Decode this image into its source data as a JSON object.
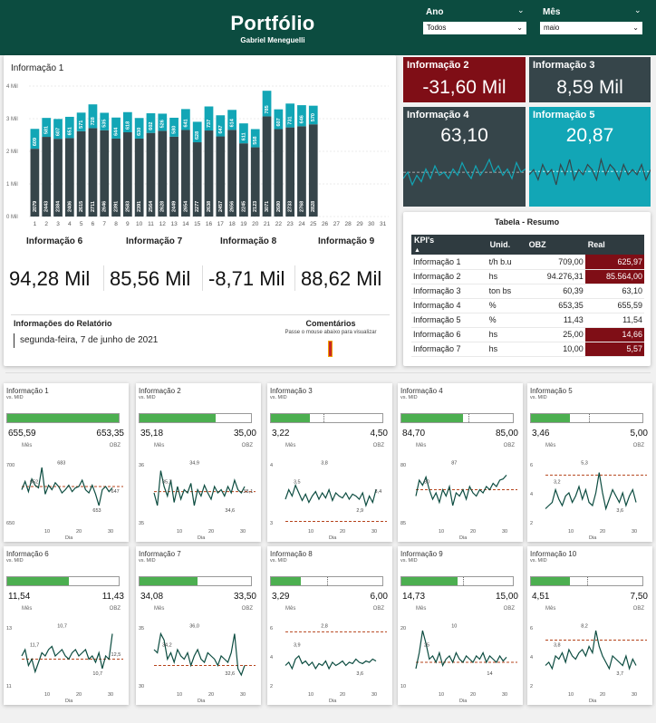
{
  "header": {
    "title": "Portfólio",
    "subtitle": "Gabriel Meneguelli",
    "ano_label": "Ano",
    "ano_value": "Todos",
    "mes_label": "Mês",
    "mes_value": "maio"
  },
  "colors": {
    "header": "#0c4c40",
    "dark": "#36454a",
    "teal": "#12a6b6",
    "red": "#7f0e16",
    "green": "#4caf50"
  },
  "main_panel": {
    "title": "Informação 1",
    "kpis": [
      {
        "label": "Informação 6",
        "value": "94,28 Mil"
      },
      {
        "label": "Informação 7",
        "value": "85,56 Mil"
      },
      {
        "label": "Informação 8",
        "value": "-8,71 Mil"
      },
      {
        "label": "Informação 9",
        "value": "88,62 Mil"
      }
    ],
    "report_label": "Informações do Relatório",
    "report_date": "segunda-feira, 7 de junho de 2021",
    "comments_label": "Comentários",
    "comments_hint": "Passe o mouse abaixo para visualizar"
  },
  "chart_data": {
    "type": "bar",
    "categories": [
      "1",
      "2",
      "3",
      "4",
      "5",
      "6",
      "7",
      "8",
      "9",
      "10",
      "11",
      "12",
      "13",
      "14",
      "15",
      "16",
      "17",
      "18",
      "19",
      "20",
      "21",
      "22",
      "23",
      "24",
      "25",
      "26",
      "27",
      "28",
      "29",
      "30",
      "31"
    ],
    "y_ticks": [
      "0 Mil",
      "1 Mil",
      "2 Mil",
      "3 Mil",
      "4 Mil"
    ],
    "ylim": [
      0,
      4000
    ],
    "series": [
      {
        "values": [
          2079,
          2443,
          2384,
          2406,
          2615,
          2711,
          2646,
          2391,
          2583,
          2391,
          2564,
          2628,
          2449,
          2654,
          2277,
          2638,
          2457,
          2656,
          2245,
          2123,
          3071,
          2680,
          2733,
          2768,
          2828,
          null,
          null,
          null,
          null,
          null,
          null
        ],
        "labels": [
          "2079",
          "2443",
          "2384",
          "2406",
          "2615",
          "2711",
          "2646",
          "2391",
          "2583",
          "2391",
          "2564",
          "2628",
          "2449",
          "2654",
          "2277",
          "2638",
          "2457",
          "2656",
          "2245",
          "2123",
          "3071",
          "2680",
          "2733",
          "2768",
          "2828",
          "",
          "",
          "",
          "",
          "",
          ""
        ]
      },
      {
        "values": [
          609,
          581,
          607,
          651,
          571,
          728,
          535,
          644,
          618,
          630,
          602,
          526,
          580,
          641,
          628,
          737,
          647,
          614,
          611,
          558,
          785,
          607,
          731,
          646,
          570,
          null,
          null,
          null,
          null,
          null,
          null
        ],
        "labels": [
          "609",
          "581",
          "607",
          "651",
          "571",
          "728",
          "535",
          "644",
          "618",
          "630",
          "602",
          "526",
          "580",
          "641",
          "628",
          "737",
          "647",
          "614",
          "611",
          "558",
          "785",
          "607",
          "731",
          "646",
          "570",
          "",
          "",
          "",
          "",
          "",
          ""
        ]
      }
    ]
  },
  "cards": [
    {
      "label": "Informação 2",
      "value": "-31,60 Mil",
      "color": "#7f0e16"
    },
    {
      "label": "Informação 3",
      "value": "8,59 Mil",
      "color": "#36454a"
    },
    {
      "label": "Informação 4",
      "value": "63,10",
      "color": "#36454a"
    },
    {
      "label": "Informação 5",
      "value": "20,87",
      "color": "#12a6b6"
    }
  ],
  "spark4": [
    60,
    62,
    58,
    61,
    59,
    63,
    60,
    64,
    61,
    62,
    60,
    63,
    61,
    65,
    62,
    60,
    64,
    61,
    63,
    66,
    62,
    64,
    61,
    63,
    60,
    65,
    62,
    63
  ],
  "spark5": [
    20,
    21,
    19,
    22,
    20,
    21,
    18,
    22,
    20,
    23,
    19,
    21,
    20,
    22,
    21,
    19,
    23,
    20,
    22,
    21,
    19,
    22,
    20,
    21,
    20,
    22,
    19,
    21
  ],
  "table": {
    "title": "Tabela - Resumo",
    "headers": [
      "KPI's",
      "Unid.",
      "OBZ",
      "Real"
    ],
    "rows": [
      {
        "kpi": "Informação 1",
        "unid": "t/h b.u",
        "obz": "709,00",
        "real": "625,97",
        "red": true
      },
      {
        "kpi": "Informação 2",
        "unid": "hs",
        "obz": "94.276,31",
        "real": "85.564,00",
        "red": true
      },
      {
        "kpi": "Informação 3",
        "unid": "ton bs",
        "obz": "60,39",
        "real": "63,10",
        "red": false
      },
      {
        "kpi": "Informação 4",
        "unid": "%",
        "obz": "653,35",
        "real": "655,59",
        "red": false
      },
      {
        "kpi": "Informação 5",
        "unid": "%",
        "obz": "11,43",
        "real": "11,54",
        "red": false
      },
      {
        "kpi": "Informação 6",
        "unid": "hs",
        "obz": "25,00",
        "real": "14,66",
        "red": true
      },
      {
        "kpi": "Informação 7",
        "unid": "hs",
        "obz": "10,00",
        "real": "5,57",
        "red": true
      }
    ]
  },
  "mini_common": {
    "sub": "vs. MID",
    "mes": "Mês",
    "obz": "OBZ",
    "dia": "Dia",
    "x_ticks": [
      "10",
      "20",
      "30"
    ]
  },
  "minis": [
    {
      "title": "Informação 1",
      "v1": "655,59",
      "v2": "653,35",
      "fill": 1.0,
      "target": null,
      "y_labels": [
        "700",
        "650"
      ],
      "pt": [
        "652",
        "683",
        "653",
        "647"
      ],
      "ref": 0.6,
      "pts": [
        0.55,
        0.68,
        0.52,
        0.72,
        0.62,
        0.58,
        0.9,
        0.48,
        0.62,
        0.55,
        0.66,
        0.6,
        0.5,
        0.55,
        0.62,
        0.52,
        0.58,
        0.6,
        0.7,
        0.55,
        0.5,
        0.62,
        0.48,
        0.3,
        0.55,
        0.6,
        0.52,
        0.58
      ]
    },
    {
      "title": "Informação 2",
      "v1": "35,18",
      "v2": "35,00",
      "fill": 0.68,
      "target": null,
      "y_labels": [
        "36",
        "35"
      ],
      "pt": [
        "35,7",
        "34,9",
        "34,6",
        "35,1"
      ],
      "ref": 0.52,
      "pts": [
        0.5,
        0.3,
        0.85,
        0.6,
        0.45,
        0.7,
        0.35,
        0.6,
        0.4,
        0.55,
        0.5,
        0.65,
        0.3,
        0.55,
        0.45,
        0.62,
        0.5,
        0.4,
        0.6,
        0.5,
        0.55,
        0.45,
        0.6,
        0.5,
        0.7,
        0.55,
        0.5,
        0.6
      ]
    },
    {
      "title": "Informação 3",
      "v1": "3,22",
      "v2": "4,50",
      "fill": 0.35,
      "target": 0.47,
      "y_labels": [
        "4",
        "3"
      ],
      "pt": [
        "3,5",
        "3,8",
        "2,9",
        "3,4"
      ],
      "ref": 0.05,
      "pts": [
        0.4,
        0.55,
        0.45,
        0.62,
        0.5,
        0.38,
        0.48,
        0.35,
        0.45,
        0.52,
        0.4,
        0.5,
        0.42,
        0.55,
        0.38,
        0.5,
        0.45,
        0.42,
        0.5,
        0.4,
        0.48,
        0.45,
        0.4,
        0.5,
        0.3,
        0.45,
        0.35,
        0.55
      ]
    },
    {
      "title": "Informação 4",
      "v1": "84,70",
      "v2": "85,00",
      "fill": 0.55,
      "target": 0.6,
      "y_labels": [
        "80",
        "85"
      ],
      "pt": [
        "80",
        "87"
      ],
      "ref": 0.55,
      "pts": [
        0.45,
        0.7,
        0.62,
        0.75,
        0.55,
        0.4,
        0.5,
        0.35,
        0.55,
        0.45,
        0.6,
        0.3,
        0.5,
        0.45,
        0.55,
        0.4,
        0.6,
        0.5,
        0.45,
        0.55,
        0.5,
        0.6,
        0.55,
        0.65,
        0.6,
        0.7,
        0.72,
        0.78
      ]
    },
    {
      "title": "Informação 5",
      "v1": "3,46",
      "v2": "5,00",
      "fill": 0.35,
      "target": 0.52,
      "y_labels": [
        "6",
        "4",
        "2"
      ],
      "pt": [
        "3,2",
        "5,3",
        "3,6"
      ],
      "ref": 0.78,
      "pts": [
        0.25,
        0.3,
        0.35,
        0.55,
        0.4,
        0.3,
        0.45,
        0.5,
        0.35,
        0.45,
        0.6,
        0.4,
        0.55,
        0.35,
        0.3,
        0.5,
        0.82,
        0.5,
        0.25,
        0.4,
        0.55,
        0.45,
        0.35,
        0.5,
        0.3,
        0.45,
        0.55,
        0.35
      ]
    },
    {
      "title": "Informação 6",
      "v1": "11,54",
      "v2": "11,43",
      "fill": 0.55,
      "target": null,
      "y_labels": [
        "13",
        "11"
      ],
      "pt": [
        "11,7",
        "10,7",
        "10,7",
        "12,5"
      ],
      "ref": 0.45,
      "pts": [
        0.5,
        0.6,
        0.35,
        0.45,
        0.25,
        0.4,
        0.55,
        0.5,
        0.6,
        0.65,
        0.5,
        0.55,
        0.6,
        0.5,
        0.45,
        0.55,
        0.6,
        0.5,
        0.55,
        0.6,
        0.45,
        0.5,
        0.4,
        0.55,
        0.3,
        0.5,
        0.45,
        0.85
      ]
    },
    {
      "title": "Informação 7",
      "v1": "34,08",
      "v2": "33,50",
      "fill": 0.52,
      "target": null,
      "y_labels": [
        "35",
        "30"
      ],
      "pt": [
        "34,2",
        "36,0",
        "32,6"
      ],
      "ref": 0.35,
      "pts": [
        0.6,
        0.55,
        0.85,
        0.75,
        0.45,
        0.55,
        0.4,
        0.6,
        0.5,
        0.45,
        0.55,
        0.35,
        0.5,
        0.6,
        0.45,
        0.4,
        0.55,
        0.5,
        0.45,
        0.35,
        0.5,
        0.45,
        0.4,
        0.55,
        0.85,
        0.3,
        0.2,
        0.35
      ]
    },
    {
      "title": "Informação 8",
      "v1": "3,29",
      "v2": "6,00",
      "fill": 0.27,
      "target": 0.5,
      "y_labels": [
        "6",
        "4",
        "2"
      ],
      "pt": [
        "3,9",
        "2,8",
        "3,6"
      ],
      "ref": 0.88,
      "pts": [
        0.35,
        0.4,
        0.3,
        0.45,
        0.5,
        0.38,
        0.42,
        0.35,
        0.4,
        0.3,
        0.38,
        0.35,
        0.42,
        0.3,
        0.4,
        0.35,
        0.38,
        0.42,
        0.35,
        0.4,
        0.38,
        0.45,
        0.4,
        0.38,
        0.42,
        0.4,
        0.45,
        0.42
      ]
    },
    {
      "title": "Informação 9",
      "v1": "14,73",
      "v2": "15,00",
      "fill": 0.5,
      "target": 0.55,
      "y_labels": [
        "20",
        "10"
      ],
      "pt": [
        "25",
        "10",
        "14"
      ],
      "ref": 0.4,
      "pts": [
        0.3,
        0.55,
        0.9,
        0.7,
        0.45,
        0.5,
        0.4,
        0.55,
        0.35,
        0.45,
        0.5,
        0.4,
        0.55,
        0.45,
        0.4,
        0.5,
        0.45,
        0.4,
        0.5,
        0.45,
        0.55,
        0.4,
        0.5,
        0.45,
        0.4,
        0.5,
        0.42,
        0.48
      ]
    },
    {
      "title": "Informação 10",
      "v1": "4,51",
      "v2": "7,50",
      "fill": 0.35,
      "target": 0.5,
      "y_labels": [
        "6",
        "4",
        "2"
      ],
      "pt": [
        "3,8",
        "8,2",
        "3,7"
      ],
      "ref": 0.75,
      "pts": [
        0.35,
        0.4,
        0.3,
        0.5,
        0.45,
        0.55,
        0.4,
        0.6,
        0.5,
        0.45,
        0.55,
        0.6,
        0.5,
        0.65,
        0.55,
        0.9,
        0.65,
        0.5,
        0.4,
        0.3,
        0.5,
        0.45,
        0.4,
        0.35,
        0.5,
        0.3,
        0.45,
        0.35
      ]
    }
  ]
}
